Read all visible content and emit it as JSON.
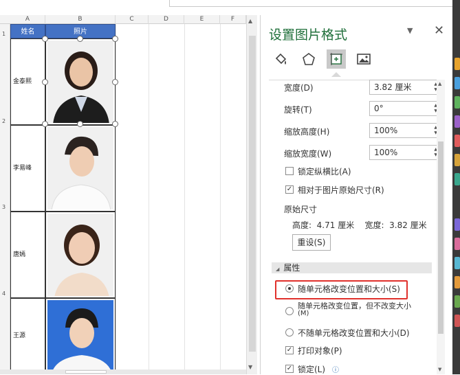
{
  "sheet": {
    "columns": [
      "A",
      "B",
      "C",
      "D",
      "E",
      "F"
    ],
    "rows": [
      "1",
      "2",
      "3",
      "4"
    ],
    "header": {
      "name": "姓名",
      "photo": "照片"
    },
    "people": [
      {
        "name": "金泰熙",
        "bg": "white"
      },
      {
        "name": "李易峰",
        "bg": "white"
      },
      {
        "name": "唐嫣",
        "bg": "white"
      },
      {
        "name": "王源",
        "bg": "blue"
      }
    ]
  },
  "pane": {
    "title": "设置图片格式",
    "dropdown_icon": "chevron-down-icon",
    "close": "✕",
    "tabs": [
      {
        "name": "fill-line-icon",
        "active": false
      },
      {
        "name": "effects-icon",
        "active": false
      },
      {
        "name": "size-properties-icon",
        "active": true
      },
      {
        "name": "picture-icon",
        "active": false
      }
    ],
    "width_label": "宽度(D)",
    "width_value": "3.82 厘米",
    "rotation_label": "旋转(T)",
    "rotation_value": "0°",
    "scale_height_label": "缩放高度(H)",
    "scale_height_value": "100%",
    "scale_width_label": "缩放宽度(W)",
    "scale_width_value": "100%",
    "lock_ratio_label": "锁定纵横比(A)",
    "lock_ratio_checked": false,
    "relative_label": "相对于图片原始尺寸(R)",
    "relative_checked": true,
    "original_size_label": "原始尺寸",
    "original_values": "高度:  4.71 厘米    宽度:  3.82 厘米",
    "reset_label": "重设(S)",
    "properties_label": "属性",
    "radio1_label": "随单元格改变位置和大小(S)",
    "radio2_label": "随单元格改变位置，但不改变大小",
    "radio2_label_cont": "(M)",
    "radio3_label": "不随单元格改变位置和大小(D)",
    "print_label": "打印对象(P)",
    "print_checked": true,
    "locked_label": "锁定(L)",
    "locked_checked": true,
    "highlight_color": "#e0302b",
    "title_color": "#1f6f3a"
  }
}
